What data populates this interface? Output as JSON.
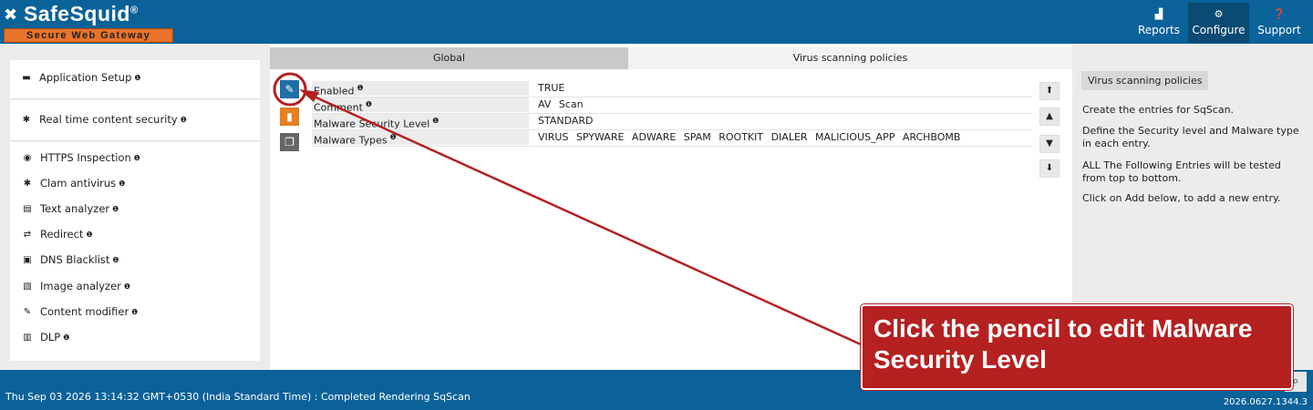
{
  "header": {
    "brand": "SafeSquid",
    "brand_mark": "®",
    "tagline": "Secure Web Gateway",
    "nav": [
      {
        "label": "Reports",
        "icon": "chart-icon"
      },
      {
        "label": "Configure",
        "icon": "gears-icon"
      },
      {
        "label": "Support",
        "icon": "question-icon"
      }
    ]
  },
  "sidebar": {
    "section1": {
      "label": "Application Setup",
      "icon": "briefcase-icon"
    },
    "section2": {
      "label": "Real time content security",
      "icon": "bug-icon"
    },
    "items": [
      {
        "label": "HTTPS Inspection",
        "icon": "eye-icon"
      },
      {
        "label": "Clam antivirus",
        "icon": "asterisk-icon"
      },
      {
        "label": "Text analyzer",
        "icon": "document-icon"
      },
      {
        "label": "Redirect",
        "icon": "shuffle-icon"
      },
      {
        "label": "DNS Blacklist",
        "icon": "dns-icon"
      },
      {
        "label": "Image analyzer",
        "icon": "image-icon"
      },
      {
        "label": "Content modifier",
        "icon": "edit-icon"
      },
      {
        "label": "DLP",
        "icon": "barcode-icon"
      }
    ],
    "info_glyph": "❶"
  },
  "main": {
    "tabs": [
      {
        "label": "Global",
        "active": true
      },
      {
        "label": "Virus scanning policies",
        "active": false
      }
    ],
    "entry": {
      "fields": [
        {
          "label": "Enabled",
          "value": "TRUE"
        },
        {
          "label": "Comment",
          "value": "AV Scan"
        },
        {
          "label": "Malware Security Level",
          "value": "STANDARD"
        },
        {
          "label": "Malware Types",
          "value": "VIRUS SPYWARE ADWARE SPAM ROOTKIT DIALER MALICIOUS_APP ARCHBOMB"
        }
      ]
    }
  },
  "help": {
    "title": "Virus scanning policies",
    "paragraphs": [
      "Create the entries for SqScan.",
      "Define the Security level and Malware type in each entry.",
      "ALL The Following Entries will be tested from top to bottom.",
      "Click on Add below, to add a new entry."
    ]
  },
  "footer": {
    "status": "Thu Sep 03 2026 13:14:32 GMT+0530 (India Standard Time) : Completed Rendering SqScan",
    "version": "2026.0627.1344.3"
  },
  "annotation": {
    "text": "Click the pencil to edit Malware Security Level",
    "color": "#b52020"
  },
  "colors": {
    "header_bg": "#0a6299",
    "edit_button": "#1f6fa8",
    "delete_button": "#e67e22",
    "copy_button": "#666666"
  }
}
